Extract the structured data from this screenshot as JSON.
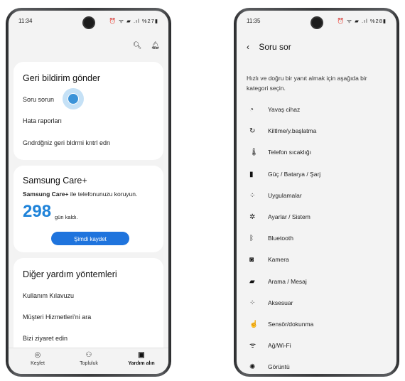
{
  "left_phone": {
    "status": {
      "time": "11:34",
      "icons": "⏰ ᯤ ▰ .ıl %27▮"
    },
    "feedback": {
      "title": "Geri bildirim gönder",
      "items": [
        "Soru sorun",
        "Hata raporları",
        "Gndrdğniz geri bldrmi kntrl edn"
      ]
    },
    "care": {
      "title": "Samsung Care+",
      "brand": "Samsung Care+",
      "subtitle_rest": " ile telefonunuzu koruyun.",
      "days": "298",
      "days_label": "gün kaldı.",
      "button": "Şimdi kaydet"
    },
    "other_help": {
      "title": "Diğer yardım yöntemleri",
      "items": [
        "Kullanım Kılavuzu",
        "Müşteri Hizmetleri'ni ara",
        "Bizi ziyaret edin"
      ]
    },
    "nav": [
      {
        "label": "Keşfet",
        "icon": "◎"
      },
      {
        "label": "Topluluk",
        "icon": "⚇"
      },
      {
        "label": "Yardım alın",
        "icon": "▣"
      }
    ],
    "accent_color": "#1f74dd"
  },
  "right_phone": {
    "status": {
      "time": "11:35",
      "icons": "⏰ ᯤ ▰ .ıl %28▮"
    },
    "title": "Soru sor",
    "intro": "Hızlı ve doğru bir yanıt almak için aşağıda bir kategori seçin.",
    "categories": [
      {
        "label": "Yavaş cihaz",
        "icon": "◔"
      },
      {
        "label": "Kiltlme/y.başlatma",
        "icon": "↻"
      },
      {
        "label": "Telefon sıcaklığı",
        "icon": "🌡"
      },
      {
        "label": "Güç / Batarya / Şarj",
        "icon": "▮"
      },
      {
        "label": "Uygulamalar",
        "icon": "⁘"
      },
      {
        "label": "Ayarlar / Sistem",
        "icon": "✲"
      },
      {
        "label": "Bluetooth",
        "icon": "ᛒ"
      },
      {
        "label": "Kamera",
        "icon": "◙"
      },
      {
        "label": "Arama / Mesaj",
        "icon": "▰"
      },
      {
        "label": "Aksesuar",
        "icon": "⁘"
      },
      {
        "label": "Sensör/dokunma",
        "icon": "☝"
      },
      {
        "label": "Ağ/Wi-Fi",
        "icon": "ᯤ"
      },
      {
        "label": "Görüntü",
        "icon": "✺"
      }
    ]
  }
}
